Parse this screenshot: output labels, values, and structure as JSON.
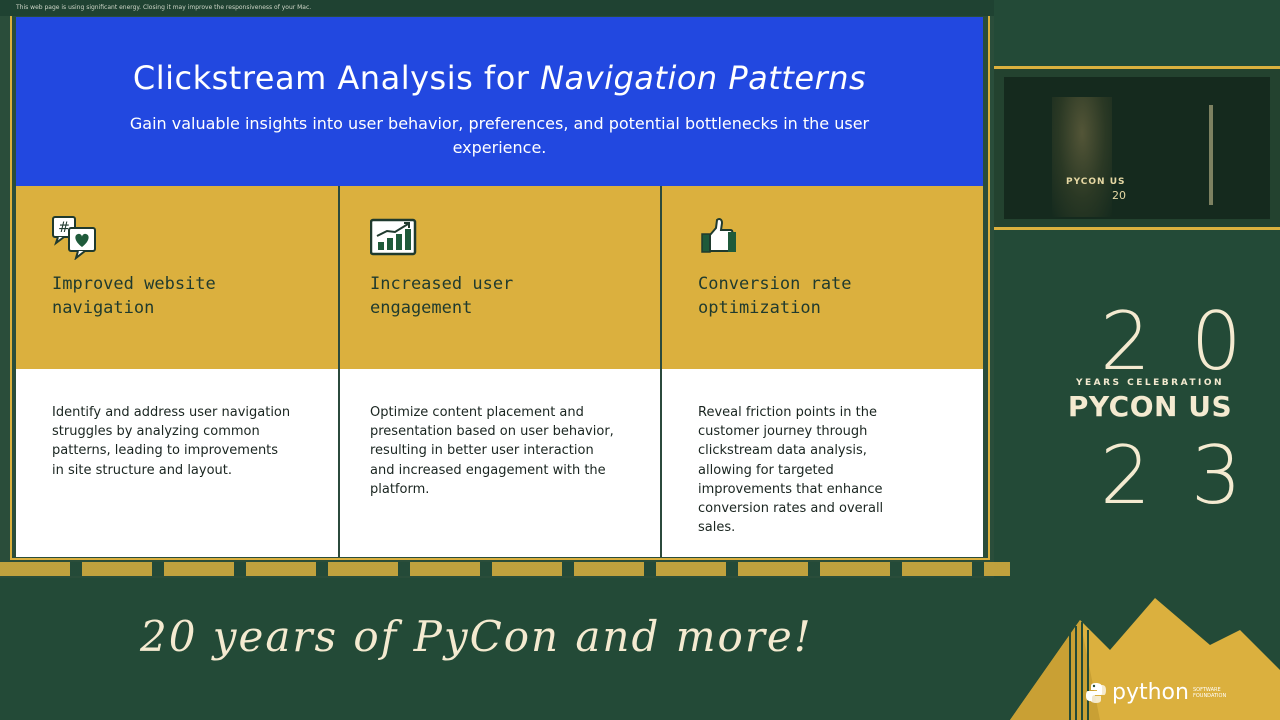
{
  "browser_warning": "This web page is using significant energy. Closing it may improve the responsiveness of your Mac.",
  "slide": {
    "title_main": "Clickstream Analysis for ",
    "title_emphasis": "Navigation Patterns",
    "subtitle": "Gain valuable insights into user behavior, preferences, and potential bottlenecks in the user experience.",
    "features": [
      {
        "icon": "hashtag-heart-chat-icon",
        "title": "Improved website navigation",
        "description": "Identify and address user navigation struggles by analyzing common patterns, leading to improvements in site structure and layout."
      },
      {
        "icon": "bar-chart-trend-icon",
        "title": "Increased user engagement",
        "description": "Optimize content placement and presentation based on user behavior, resulting in better user interaction and increased engagement with the platform."
      },
      {
        "icon": "thumbs-up-icon",
        "title": "Conversion rate optimization",
        "description": "Reveal friction points in the customer journey through clickstream data analysis, allowing for targeted improvements that enhance conversion rates and overall sales."
      }
    ]
  },
  "camera": {
    "label": "PYCON US",
    "label2": "20"
  },
  "branding": {
    "year_top": "20",
    "years_celebration": "YEARS CELEBRATION",
    "event": "PYCON US",
    "year_bottom": "23",
    "tagline": "20 years of PyCon and more!",
    "python_word": "python",
    "python_small": "SOFTWARE FOUNDATION"
  },
  "colors": {
    "background": "#234a37",
    "hero_blue": "#2248e0",
    "gold": "#dbb03e",
    "cream": "#f4ead0",
    "dark_green": "#1f3a2e"
  }
}
